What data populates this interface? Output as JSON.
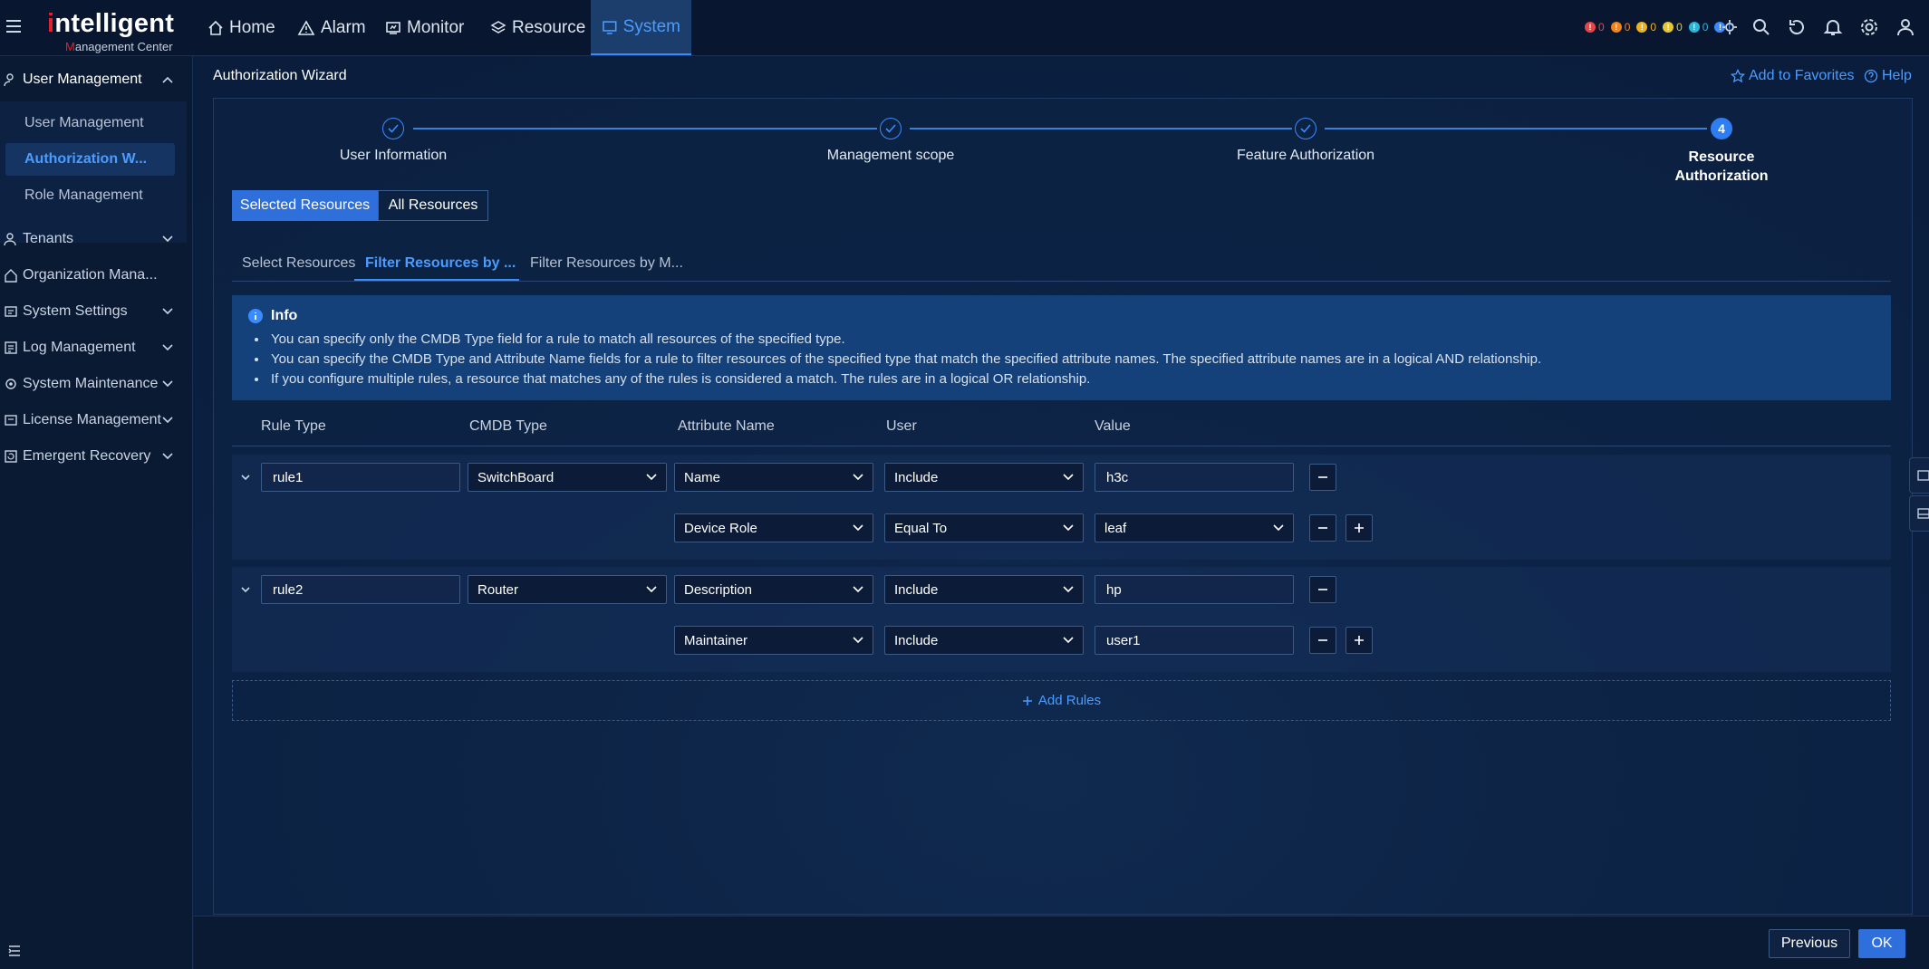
{
  "logo": {
    "word_first": "i",
    "word_rest": "ntelligent",
    "sub_first": "M",
    "sub_rest": "anagement Center"
  },
  "nav": [
    {
      "label": "Home"
    },
    {
      "label": "Alarm"
    },
    {
      "label": "Monitor"
    },
    {
      "label": "Resource"
    },
    {
      "label": "System"
    }
  ],
  "alarms": [
    {
      "count": "0",
      "color": "#e54545"
    },
    {
      "count": "0",
      "color": "#f0831c"
    },
    {
      "count": "0",
      "color": "#f0b21c"
    },
    {
      "count": "0",
      "color": "#e4c832"
    },
    {
      "count": "0",
      "color": "#2bb6d8"
    },
    {
      "count": "0",
      "color": "#3a8bff"
    }
  ],
  "sidebar": {
    "user_management": "User Management",
    "subs": [
      "User Management",
      "Authorization W...",
      "Role Management"
    ],
    "items": [
      "Tenants",
      "Organization Mana...",
      "System Settings",
      "Log Management",
      "System Maintenance",
      "License Management",
      "Emergent Recovery"
    ]
  },
  "header": {
    "title": "Authorization Wizard",
    "favorites": "Add to Favorites",
    "help": "Help"
  },
  "steps": [
    {
      "label": "User Information"
    },
    {
      "label": "Management scope"
    },
    {
      "label": "Feature Authorization"
    },
    {
      "label_line1": "Resource",
      "label_line2": "Authorization",
      "number": "4"
    }
  ],
  "segments": {
    "selected": "Selected Resources",
    "all": "All Resources"
  },
  "tabs": [
    "Select Resources",
    "Filter Resources by ...",
    "Filter Resources by M..."
  ],
  "info": {
    "title": "Info",
    "lines": [
      "You can specify only the CMDB Type field for a rule to match all resources of the specified type.",
      "You can specify the CMDB Type and Attribute Name fields for a rule to filter resources of the specified type that match the specified attribute names. The specified attribute names are in a logical AND relationship.",
      "If you configure multiple rules, a resource that matches any of the rules is considered a match. The rules are in a logical OR relationship."
    ]
  },
  "table": {
    "headers": [
      "Rule Type",
      "CMDB Type",
      "Attribute Name",
      "User",
      "Value"
    ],
    "rules": [
      {
        "name": "rule1",
        "cmdb": "SwitchBoard",
        "conditions": [
          {
            "attribute": "Name",
            "op": "Include",
            "value": "h3c"
          },
          {
            "attribute": "Device Role",
            "op": "Equal To",
            "value": "leaf"
          }
        ]
      },
      {
        "name": "rule2",
        "cmdb": "Router",
        "conditions": [
          {
            "attribute": "Description",
            "op": "Include",
            "value": "hp"
          },
          {
            "attribute": "Maintainer",
            "op": "Include",
            "value": "user1"
          }
        ]
      }
    ],
    "add_rules": "Add Rules"
  },
  "footer": {
    "previous": "Previous",
    "ok": "OK"
  },
  "colors": {
    "accent": "#3a8bff",
    "primary_button": "#2f6fdc"
  }
}
